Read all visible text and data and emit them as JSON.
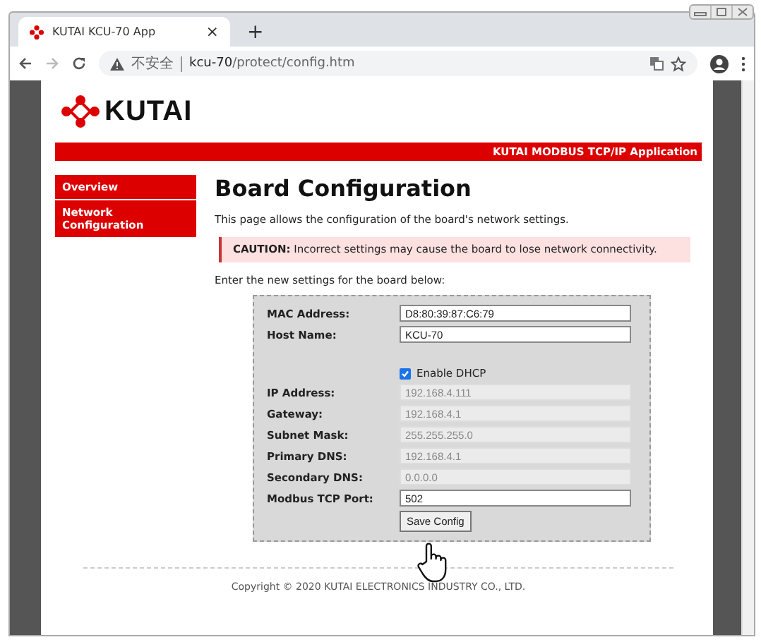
{
  "browser": {
    "tab_title": "KUTAI KCU-70 App",
    "tab_close": "×",
    "new_tab": "+",
    "security": "不安全",
    "url_host": "kcu-70",
    "url_path": "/protect/config.htm"
  },
  "page": {
    "logo": "KUTAI",
    "banner": "KUTAI MODBUS TCP/IP Application",
    "nav": [
      {
        "label": "Overview"
      },
      {
        "label": "Network Configuration"
      }
    ],
    "heading": "Board Configuration",
    "intro": "This page allows the configuration of the board's network settings.",
    "caution": "**CAUTION:** Incorrect settings may cause the board to lose network connectivity.",
    "prompt": "Enter the new settings for the board below:",
    "form": {
      "rows": [
        {
          "kind": "field",
          "label": "MAC Address:",
          "value": "D8:80:39:87:C6:79",
          "disabled": false
        },
        {
          "kind": "field",
          "label": "Host Name:",
          "value": "KCU-70",
          "disabled": false
        },
        {
          "kind": "checkbox",
          "label": "Enable DHCP",
          "checked": true
        },
        {
          "kind": "field",
          "label": "IP Address:",
          "value": "192.168.4.111",
          "disabled": true
        },
        {
          "kind": "field",
          "label": "Gateway:",
          "value": "192.168.4.1",
          "disabled": true
        },
        {
          "kind": "field",
          "label": "Subnet Mask:",
          "value": "255.255.255.0",
          "disabled": true
        },
        {
          "kind": "field",
          "label": "Primary DNS:",
          "value": "192.168.4.1",
          "disabled": true
        },
        {
          "kind": "field",
          "label": "Secondary DNS:",
          "value": "0.0.0.0",
          "disabled": true
        },
        {
          "kind": "field",
          "label": "Modbus TCP Port:",
          "value": "502",
          "disabled": false
        }
      ],
      "submit": "Save Config"
    },
    "footer": "Copyright © 2020 KUTAI ELECTRONICS INDUSTRY CO., LTD."
  }
}
